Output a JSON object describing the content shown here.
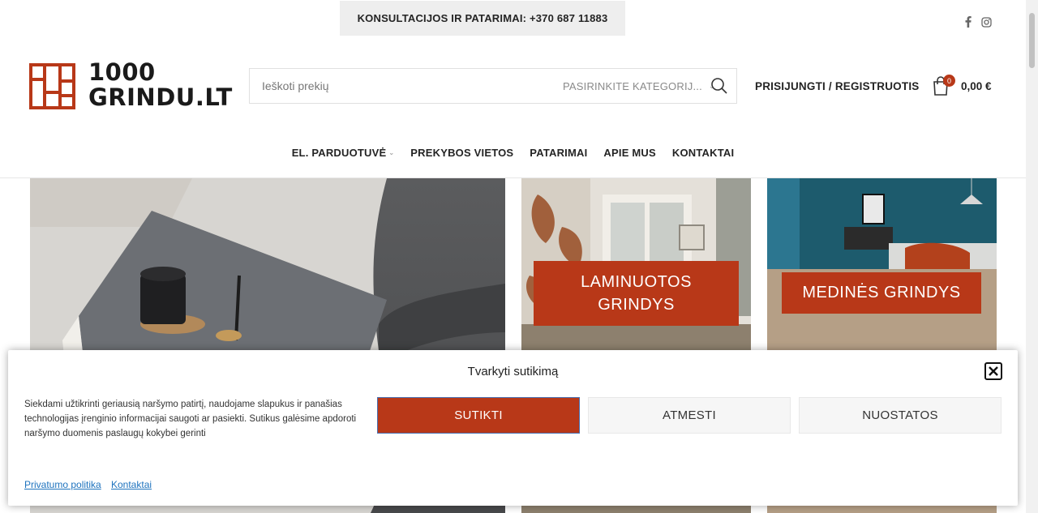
{
  "topbar": {
    "consult_text": "KONSULTACIJOS IR PATARIMAI: +370 687 11883",
    "social": [
      "facebook-icon",
      "instagram-icon"
    ]
  },
  "header": {
    "logo_line1": "1000",
    "logo_line2": "GRINDU.LT",
    "search_placeholder": "Ieškoti prekių",
    "category_select": "PASIRINKITE KATEGORIJ...",
    "login_label": "PRISIJUNGTI / REGISTRUOTIS",
    "cart_count": "0",
    "cart_total": "0,00 €"
  },
  "nav": {
    "items": [
      {
        "label": "EL. PARDUOTUVĖ",
        "has_dropdown": true
      },
      {
        "label": "PREKYBOS VIETOS"
      },
      {
        "label": "PATARIMAI"
      },
      {
        "label": "APIE MUS"
      },
      {
        "label": "KONTAKTAI"
      }
    ]
  },
  "banners": {
    "laminated_line1": "LAMINUOTOS",
    "laminated_line2": "GRINDYS",
    "wooden": "MEDINĖS GRINDYS"
  },
  "consent": {
    "title": "Tvarkyti sutikimą",
    "text": "Siekdami užtikrinti geriausią naršymo patirtį, naudojame slapukus ir panašias technologijas įrenginio informacijai saugoti ar pasiekti. Sutikus galėsime apdoroti naršymo duomenis paslaugų kokybei gerinti",
    "accept_label": "SUTIKTI",
    "deny_label": "ATMESTI",
    "prefs_label": "NUOSTATOS",
    "privacy_link": "Privatumo politika",
    "contacts_link": "Kontaktai"
  },
  "colors": {
    "brand": "#b83818",
    "text_dark": "#242424",
    "link": "#1e73be"
  }
}
